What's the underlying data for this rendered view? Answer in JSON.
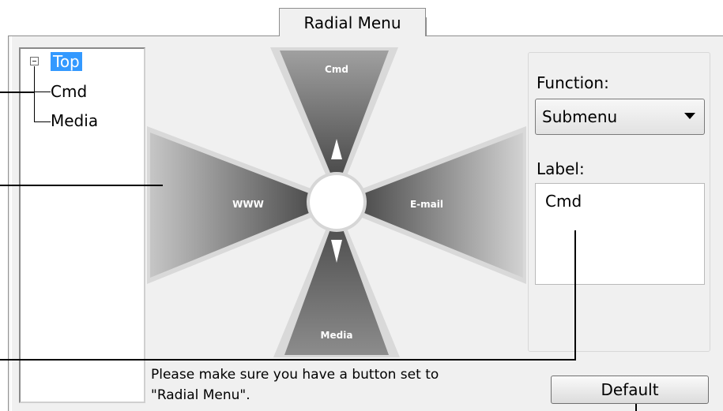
{
  "tab": {
    "label": "Radial Menu"
  },
  "tree": {
    "items": [
      {
        "label": "Top",
        "selected": true,
        "expander": "collapse-minus-icon"
      },
      {
        "label": "Cmd"
      },
      {
        "label": "Media"
      }
    ]
  },
  "radial": {
    "segments": [
      {
        "label": "Cmd",
        "direction": "top"
      },
      {
        "label": "E-mail",
        "direction": "right"
      },
      {
        "label": "Media",
        "direction": "bottom"
      },
      {
        "label": "WWW",
        "direction": "left"
      }
    ]
  },
  "function": {
    "label": "Function:",
    "value": "Submenu"
  },
  "label_field": {
    "label": "Label:",
    "value": "Cmd"
  },
  "note": {
    "line1": "Please make sure you have a button set to",
    "line2": "\"Radial Menu\"."
  },
  "default_button": {
    "label": "Default"
  },
  "colors": {
    "selection": "#3399ff",
    "panel": "#f0f0f0",
    "segment_light": "#dedede",
    "segment_dark": "#5c5c5c"
  }
}
